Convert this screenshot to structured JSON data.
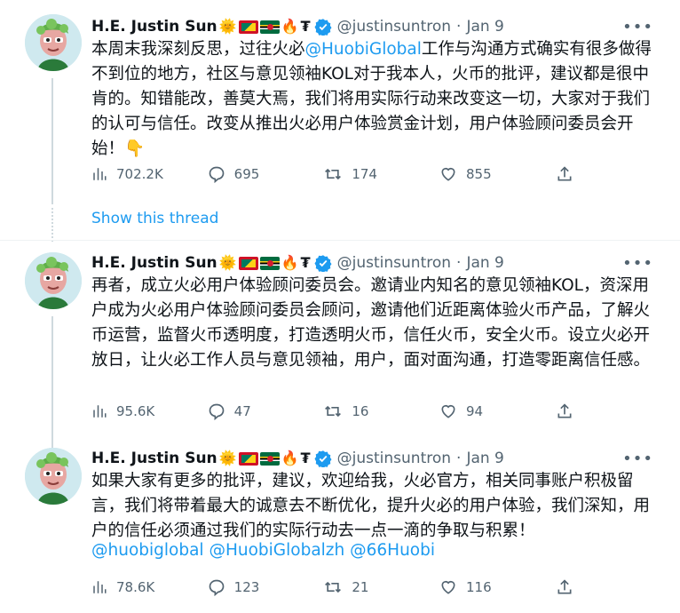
{
  "colors": {
    "link": "#1d9bf0",
    "muted": "#536471",
    "text": "#0f1419",
    "verified": "#1d9bf0"
  },
  "author": {
    "name": "H.E. Justin Sun",
    "name_emoji": [
      "🌞",
      "flag-grenada-icon",
      "flag-dominica-icon",
      "🔥",
      "₮"
    ],
    "handle": "@justinsuntron"
  },
  "show_thread_label": "Show this thread",
  "tweets": [
    {
      "date": "Jan 9",
      "text_before_link": "本周末我深刻反思，过往火必",
      "link": "@HuobiGlobal",
      "text_after_link": "工作与沟通方式确实有很多做得不到位的地方，社区与意见领袖KOL对于我本人，火币的批评，建议都是很中肯的。知错能改，善莫大焉，我们将用实际行动来改变这一切，大家对于我们的认可与信任。改变从推出火必用户体验赏金计划，用户体验顾问委员会开始！👇",
      "stats": {
        "views": "702.2K",
        "replies": "695",
        "retweets": "174",
        "likes": "855"
      }
    },
    {
      "date": "Jan 9",
      "text": "再者，成立火必用户体验顾问委员会。邀请业内知名的意见领袖KOL，资深用户成为火必用户体验顾问委员会顾问，邀请他们近距离体验火币产品，了解火币运营，监督火币透明度，打造透明火币，信任火币，安全火币。设立火必开放日，让火必工作人员与意见领袖，用户，面对面沟通，打造零距离信任感。",
      "stats": {
        "views": "95.6K",
        "replies": "47",
        "retweets": "16",
        "likes": "94"
      }
    },
    {
      "date": "Jan 9",
      "text": "如果大家有更多的批评，建议，欢迎给我，火必官方，相关同事账户积极留言，我们将带着最大的诚意去不断优化，提升火必的用户体验，我们深知，用户的信任必须通过我们的实际行动去一点一滴的争取与积累！",
      "mentions": "@huobiglobal @HuobiGlobalzh @66Huobi",
      "stats": {
        "views": "78.6K",
        "replies": "123",
        "retweets": "21",
        "likes": "116"
      }
    }
  ]
}
